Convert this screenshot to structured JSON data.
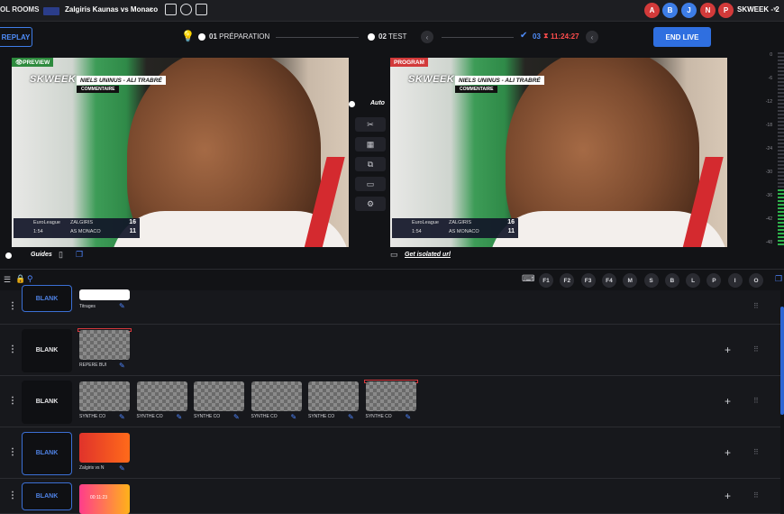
{
  "topbar": {
    "rooms_label": "OL ROOMS",
    "match_title": "Zalgiris Kaunas vs Monaco",
    "icons": [
      "calendar-icon",
      "globe-icon",
      "grid-icon"
    ],
    "avatars": [
      {
        "letter": "A",
        "color": "#d23a3a"
      },
      {
        "letter": "B",
        "color": "#3d7de6"
      },
      {
        "letter": "J",
        "color": "#3d7de6"
      },
      {
        "letter": "N",
        "color": "#d23a3a"
      },
      {
        "letter": "P",
        "color": "#d23a3a"
      }
    ],
    "account": "SKWEEK - 2"
  },
  "stepsbar": {
    "replay": "REPLAY",
    "step1_num": "01",
    "step1_label": "PRÉPARATION",
    "step2_num": "02",
    "step2_label": "TEST",
    "step3_num": "03",
    "step3_time": "11:24:27",
    "end_live": "END LIVE"
  },
  "preview": {
    "tag": "PREVIEW",
    "brand": "SKWEEK",
    "name": "NIELS UNINUS - ALI TRABRÉ",
    "sub": "COMMENTAIRE",
    "score": {
      "team1": "ZALGIRIS",
      "team2": "AS MONACO",
      "league": "EuroLeague",
      "clock": "1:54",
      "score1": "16",
      "score2": "11"
    },
    "guides_label": "Guides"
  },
  "program": {
    "tag": "PROGRAM",
    "brand": "SKWEEK",
    "name": "NIELS UNINUS - ALI TRABRÉ",
    "sub": "COMMENTAIRE",
    "score": {
      "team1": "ZALGIRIS",
      "team2": "AS MONACO",
      "league": "EuroLeague",
      "clock": "1:54",
      "score1": "16",
      "score2": "11"
    },
    "isolated_label": "Get isolated url"
  },
  "tools": {
    "auto_label": "Auto"
  },
  "meter": {
    "ticks": [
      "0",
      "-6",
      "-12",
      "-18",
      "-24",
      "-30",
      "-36",
      "-42",
      "-48"
    ],
    "level": 0.3
  },
  "fkeys": [
    "F1",
    "F2",
    "F3",
    "F4",
    "M",
    "S",
    "B",
    "L",
    "P",
    "I",
    "O"
  ],
  "rows": [
    {
      "blank": "BLANK",
      "items": [
        {
          "label": "Titrages"
        }
      ]
    },
    {
      "blank": "BLANK",
      "items": [
        {
          "label": "REPERE BUI"
        }
      ]
    },
    {
      "blank": "BLANK",
      "items": [
        {
          "label": "SYNTHE CO"
        },
        {
          "label": "SYNTHE CO"
        },
        {
          "label": "SYNTHE CO"
        },
        {
          "label": "SYNTHE CO"
        },
        {
          "label": "SYNTHE CO"
        },
        {
          "label": "SYNTHE CO"
        }
      ]
    },
    {
      "blank": "BLANK",
      "items": [
        {
          "label": "Zalgiris vs N"
        }
      ]
    },
    {
      "blank": "BLANK",
      "items": [
        {
          "label": "00:11:23"
        }
      ]
    }
  ]
}
